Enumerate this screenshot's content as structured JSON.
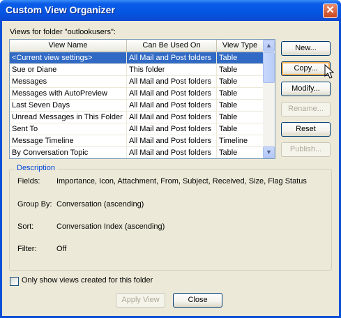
{
  "window": {
    "title": "Custom View Organizer",
    "close_glyph": "✕"
  },
  "views_label": "Views for folder \"outlookusers\":",
  "table": {
    "columns": [
      "View Name",
      "Can Be Used On",
      "View Type"
    ],
    "rows": [
      [
        "<Current view settings>",
        "All Mail and Post folders",
        "Table"
      ],
      [
        "Sue or Diane",
        "This folder",
        "Table"
      ],
      [
        "Messages",
        "All Mail and Post folders",
        "Table"
      ],
      [
        "Messages with AutoPreview",
        "All Mail and Post folders",
        "Table"
      ],
      [
        "Last Seven Days",
        "All Mail and Post folders",
        "Table"
      ],
      [
        "Unread Messages in This Folder",
        "All Mail and Post folders",
        "Table"
      ],
      [
        "Sent To",
        "All Mail and Post folders",
        "Table"
      ],
      [
        "Message Timeline",
        "All Mail and Post folders",
        "Timeline"
      ],
      [
        "By Conversation Topic",
        "All Mail and Post folders",
        "Table"
      ]
    ],
    "selected_row": 0
  },
  "buttons": {
    "new": "New...",
    "copy": "Copy...",
    "modify": "Modify...",
    "rename": "Rename...",
    "reset": "Reset",
    "publish": "Publish...",
    "apply_view": "Apply View",
    "close": "Close"
  },
  "description": {
    "legend": "Description",
    "fields_label": "Fields:",
    "fields_value": "Importance, Icon, Attachment, From, Subject, Received, Size, Flag Status",
    "group_by_label": "Group By:",
    "group_by_value": "Conversation (ascending)",
    "sort_label": "Sort:",
    "sort_value": "Conversation Index (ascending)",
    "filter_label": "Filter:",
    "filter_value": "Off"
  },
  "only_show_label": "Only show views created for this folder",
  "colors": {
    "title_blue": "#0555e3",
    "selection": "#316ac5",
    "dialog_bg": "#ece9d8",
    "legend_blue": "#0046d5"
  }
}
